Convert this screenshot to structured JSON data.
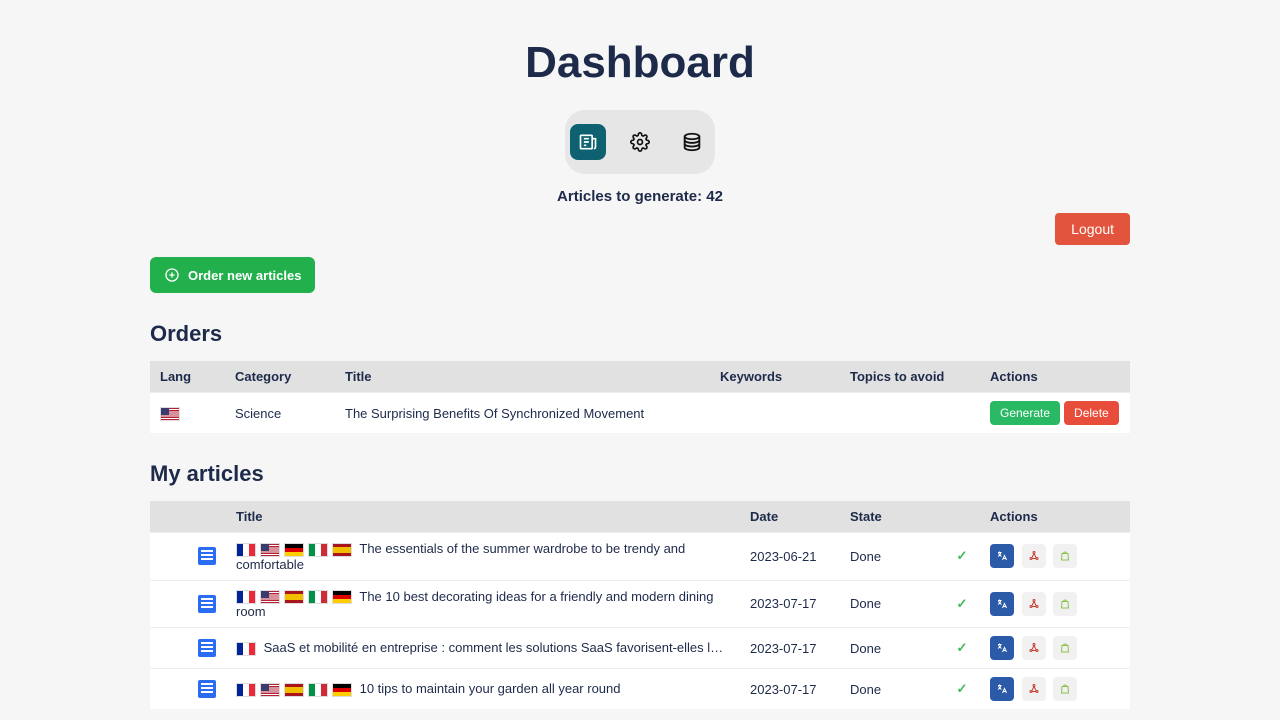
{
  "page": {
    "title": "Dashboard"
  },
  "status": {
    "label": "Articles to generate: 42"
  },
  "buttons": {
    "logout": "Logout",
    "order_new": "Order new articles",
    "generate": "Generate",
    "delete": "Delete"
  },
  "sections": {
    "orders": "Orders",
    "my_articles": "My articles"
  },
  "orders_table": {
    "headers": {
      "lang": "Lang",
      "category": "Category",
      "title": "Title",
      "keywords": "Keywords",
      "topics": "Topics to avoid",
      "actions": "Actions"
    },
    "rows": [
      {
        "lang": "us",
        "category": "Science",
        "title": "The Surprising Benefits Of Synchronized Movement",
        "keywords": "",
        "topics": ""
      }
    ]
  },
  "articles_table": {
    "headers": {
      "pre": "",
      "title": "Title",
      "date": "Date",
      "state": "State",
      "actions": "Actions"
    },
    "rows": [
      {
        "flags": [
          "fr",
          "us",
          "de",
          "it",
          "es"
        ],
        "title": "The essentials of the summer wardrobe to be trendy and comfortable",
        "date": "2023-06-21",
        "state": "Done"
      },
      {
        "flags": [
          "fr",
          "us",
          "es",
          "it",
          "de"
        ],
        "title": "The 10 best decorating ideas for a friendly and modern dining room",
        "date": "2023-07-17",
        "state": "Done"
      },
      {
        "flags": [
          "fr"
        ],
        "title": "SaaS et mobilité en entreprise : comment les solutions SaaS favorisent-elles le travail à distance et la…",
        "date": "2023-07-17",
        "state": "Done"
      },
      {
        "flags": [
          "fr",
          "us",
          "es",
          "it",
          "de"
        ],
        "title": "10 tips to maintain your garden all year round",
        "date": "2023-07-17",
        "state": "Done"
      }
    ]
  }
}
